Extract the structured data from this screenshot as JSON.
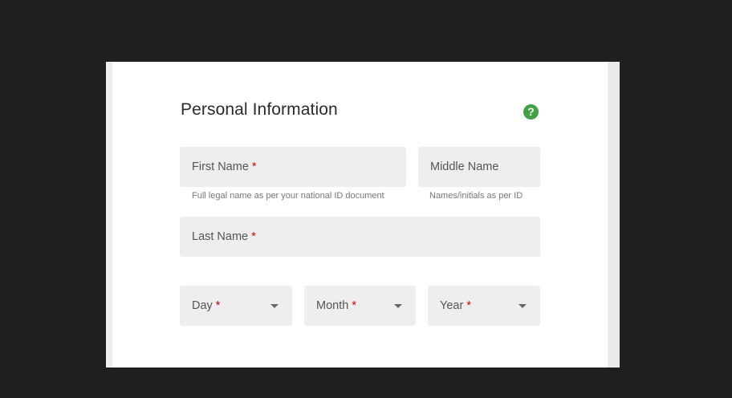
{
  "form": {
    "title": "Personal Information",
    "help_glyph": "?",
    "required_mark": "*",
    "fields": {
      "first_name": {
        "label": "First Name",
        "required": true,
        "helper": "Full legal name as per your national ID document"
      },
      "middle_name": {
        "label": "Middle Name",
        "required": false,
        "helper": "Names/initials as per ID"
      },
      "last_name": {
        "label": "Last Name",
        "required": true
      },
      "day": {
        "label": "Day",
        "required": true
      },
      "month": {
        "label": "Month",
        "required": true
      },
      "year": {
        "label": "Year",
        "required": true
      }
    }
  },
  "icons": {
    "help": "question-circle-icon",
    "dropdown": "caret-down-icon"
  },
  "colors": {
    "background": "#1f1f1f",
    "card": "#ffffff",
    "field_bg": "#eeeeee",
    "accent_help": "#43a047",
    "required": "#d50000"
  }
}
